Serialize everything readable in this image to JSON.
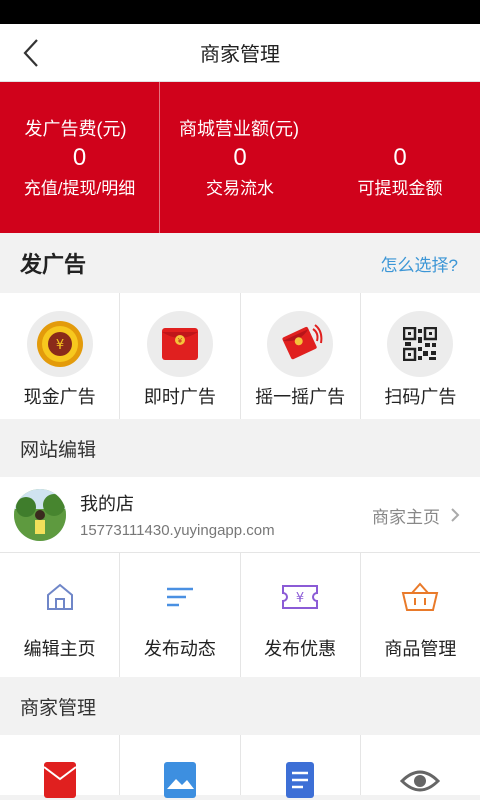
{
  "header": {
    "title": "商家管理"
  },
  "stats": {
    "ad_fee": {
      "label": "发广告费(元)",
      "value": "0",
      "action": "充值/提现/明细"
    },
    "mall_revenue": {
      "label": "商城营业额(元)"
    },
    "transactions": {
      "value": "0",
      "label": "交易流水"
    },
    "withdrawable": {
      "value": "0",
      "label": "可提现金额"
    }
  },
  "ads_section": {
    "title": "发广告",
    "help_link": "怎么选择?",
    "items": [
      {
        "label": "现金广告",
        "icon": "gold-coin-icon"
      },
      {
        "label": "即时广告",
        "icon": "red-envelope-icon"
      },
      {
        "label": "摇一摇广告",
        "icon": "shake-envelope-icon"
      },
      {
        "label": "扫码广告",
        "icon": "qr-code-icon"
      }
    ]
  },
  "site_edit": {
    "title": "网站编辑",
    "store": {
      "name": "我的店",
      "url": "15773111430.yuyingapp.com",
      "home_link": "商家主页"
    },
    "items": [
      {
        "label": "编辑主页",
        "icon": "home-icon"
      },
      {
        "label": "发布动态",
        "icon": "lines-icon"
      },
      {
        "label": "发布优惠",
        "icon": "coupon-icon"
      },
      {
        "label": "商品管理",
        "icon": "basket-icon"
      }
    ]
  },
  "merchant_mgmt": {
    "title": "商家管理",
    "items": [
      {
        "icon": "envelope-icon"
      },
      {
        "icon": "image-icon"
      },
      {
        "icon": "document-icon"
      },
      {
        "icon": "eye-icon"
      }
    ]
  },
  "colors": {
    "brand_red": "#d0021b",
    "link_blue": "#3c96d6"
  }
}
